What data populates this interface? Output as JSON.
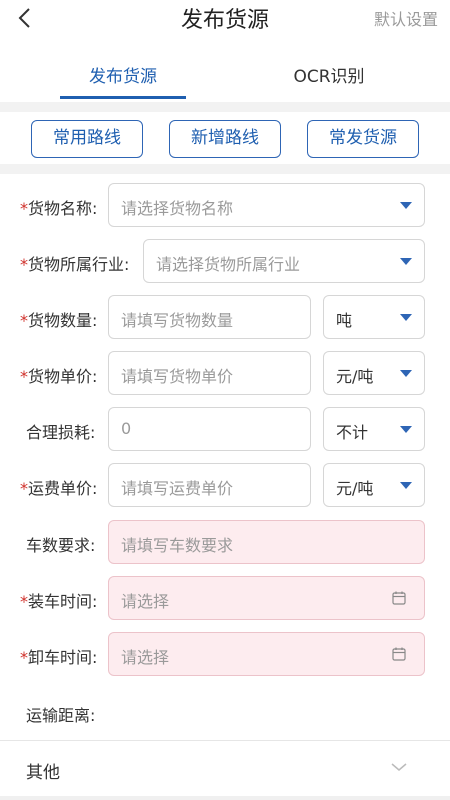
{
  "header": {
    "title": "发布货源",
    "right": "默认设置"
  },
  "tabs": [
    {
      "label": "发布货源"
    },
    {
      "label": "OCR识别"
    }
  ],
  "quick_buttons": [
    {
      "label": "常用路线"
    },
    {
      "label": "新增路线"
    },
    {
      "label": "常发货源"
    }
  ],
  "form": {
    "cargo_name": {
      "required": "*",
      "label": "货物名称:",
      "placeholder": "请选择货物名称"
    },
    "industry": {
      "required": "*",
      "label": "货物所属行业:",
      "placeholder": "请选择货物所属行业"
    },
    "quantity": {
      "required": "*",
      "label": "货物数量:",
      "placeholder": "请填写货物数量",
      "unit": "吨"
    },
    "unit_price": {
      "required": "*",
      "label": "货物单价:",
      "placeholder": "请填写货物单价",
      "unit": "元/吨"
    },
    "loss": {
      "label": "合理损耗:",
      "value": "0",
      "unit": "不计"
    },
    "freight": {
      "required": "*",
      "label": "运费单价:",
      "placeholder": "请填写运费单价",
      "unit": "元/吨"
    },
    "trucks": {
      "label": "车数要求:",
      "placeholder": "请填写车数要求"
    },
    "load_time": {
      "required": "*",
      "label": "装车时间:",
      "placeholder": "请选择"
    },
    "unload_time": {
      "required": "*",
      "label": "卸车时间:",
      "placeholder": "请选择"
    },
    "distance": {
      "label": "运输距离:"
    }
  },
  "other": {
    "label": "其他"
  },
  "colors": {
    "accent": "#1f5fb0",
    "required": "#d0302a",
    "pink_field": "#fdecef"
  }
}
